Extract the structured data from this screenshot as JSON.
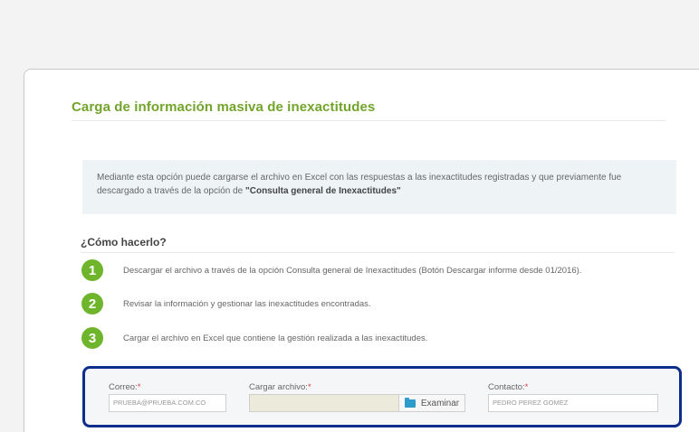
{
  "panel": {
    "title": "Carga de información masiva de inexactitudes"
  },
  "info": {
    "text_before": "Mediante esta opción puede cargarse el archivo en Excel con las respuestas a las inexactitudes registradas y que previamente fue descargado a través de la opción de ",
    "link_text": "\"Consulta general de Inexactitudes\""
  },
  "how_to": {
    "title": "¿Cómo hacerlo?",
    "steps": [
      {
        "number": "1",
        "text": "Descargar el archivo a través de la opción Consulta general de Inexactitudes (Botón Descargar informe desde 01/2016)."
      },
      {
        "number": "2",
        "text": "Revisar la información y gestionar las inexactitudes encontradas."
      },
      {
        "number": "3",
        "text": "Cargar el archivo en Excel que contiene la gestión realizada a las inexactitudes."
      }
    ]
  },
  "form": {
    "email": {
      "label": "Correo:",
      "required_mark": "*",
      "value": "PRUEBA@PRUEBA.COM.CO"
    },
    "file": {
      "label": "Cargar archivo:",
      "required_mark": "*",
      "browse_label": "Examinar"
    },
    "contact": {
      "label": "Contacto:",
      "required_mark": "*",
      "value": "PEDRO PEREZ GOMEZ"
    }
  },
  "colors": {
    "title_green": "#72a42c",
    "step_green": "#6fb52c",
    "highlight_border": "#0d2e8c",
    "info_bg": "#eef3f6",
    "required_red": "#e23b3b",
    "folder_icon": "#2e9ccb"
  },
  "icons": [
    "folder-icon"
  ]
}
